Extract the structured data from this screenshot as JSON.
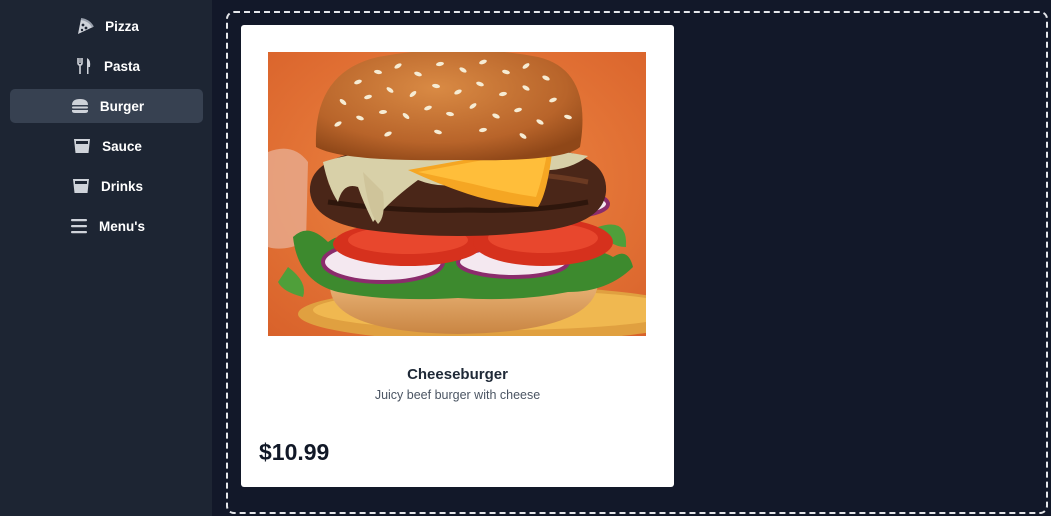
{
  "sidebar": {
    "items": [
      {
        "label": "Pizza",
        "icon": "pizza-icon",
        "active": false
      },
      {
        "label": "Pasta",
        "icon": "fork-knife-icon",
        "active": false
      },
      {
        "label": "Burger",
        "icon": "burger-icon",
        "active": true
      },
      {
        "label": "Sauce",
        "icon": "bowl-icon",
        "active": false
      },
      {
        "label": "Drinks",
        "icon": "glass-icon",
        "active": false
      },
      {
        "label": "Menu's",
        "icon": "menu-lines-icon",
        "active": false
      }
    ]
  },
  "product": {
    "name": "Cheeseburger",
    "description": "Juicy beef burger with cheese",
    "price": "$10.99",
    "image": "cheeseburger-photo"
  },
  "colors": {
    "page_background": "#121829",
    "sidebar_background": "#1d2533",
    "active_item_background": "#374151",
    "card_background": "#ffffff",
    "dropzone_border": "#e5e7eb"
  }
}
